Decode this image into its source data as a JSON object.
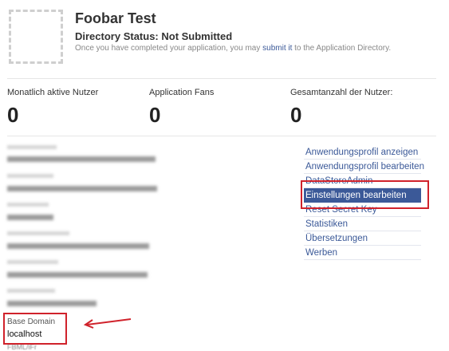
{
  "header": {
    "title": "Foobar Test",
    "status": "Directory Status: Not Submitted",
    "note_before": "Once you have completed your application, you may ",
    "note_link": "submit it",
    "note_after": " to the Application Directory."
  },
  "stats": [
    {
      "label": "Monatlich aktive Nutzer",
      "value": "0"
    },
    {
      "label": "Application Fans",
      "value": "0"
    },
    {
      "label": "Gesamtanzahl der Nutzer:",
      "value": "0"
    }
  ],
  "details": {
    "base_domain_label": "Base Domain",
    "base_domain_value": "localhost",
    "trailing_label": "FBML/iFr"
  },
  "menu": [
    "Anwendungsprofil anzeigen",
    "Anwendungsprofil bearbeiten",
    "DataStoreAdmin",
    "Einstellungen bearbeiten",
    "Reset Secret Key",
    "Statistiken",
    "Übersetzungen",
    "Werben"
  ],
  "colors": {
    "link": "#3b5998",
    "selected_bg": "#3b5998",
    "annotation": "#d0222b"
  }
}
